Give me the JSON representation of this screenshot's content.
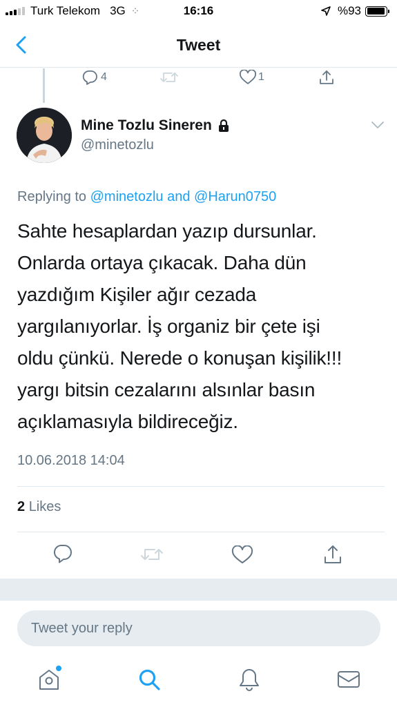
{
  "status_bar": {
    "carrier": "Turk Telekom",
    "network": "3G",
    "time": "16:16",
    "battery": "%93",
    "battery_level": 0.93
  },
  "nav": {
    "title": "Tweet"
  },
  "previous_tweet": {
    "reply_count": "4",
    "like_count": "1"
  },
  "tweet": {
    "display_name": "Mine Tozlu Sineren",
    "handle": "@minetozlu",
    "replying_prefix": "Replying to ",
    "replying_to_1": "@minetozlu",
    "replying_and": " and ",
    "replying_to_2": "@Harun0750",
    "text": "Sahte hesaplardan yazıp dursunlar.\nOnlarda ortaya çıkacak. Daha dün\nyazdığım Kişiler ağır cezada\nyargılanıyorlar. İş organiz bir çete işi\noldu çünkü. Nerede o konuşan kişilik!!!\nyargı bitsin cezalarını alsınlar basın\naçıklamasıyla bildireceğiz.",
    "timestamp": "10.06.2018 14:04",
    "likes_count": "2",
    "likes_label": "Likes"
  },
  "reply": {
    "placeholder": "Tweet your reply"
  },
  "icons": {
    "accent": "#1da1f2",
    "muted": "#657786",
    "retweet_disabled": "#ccd6dd"
  }
}
